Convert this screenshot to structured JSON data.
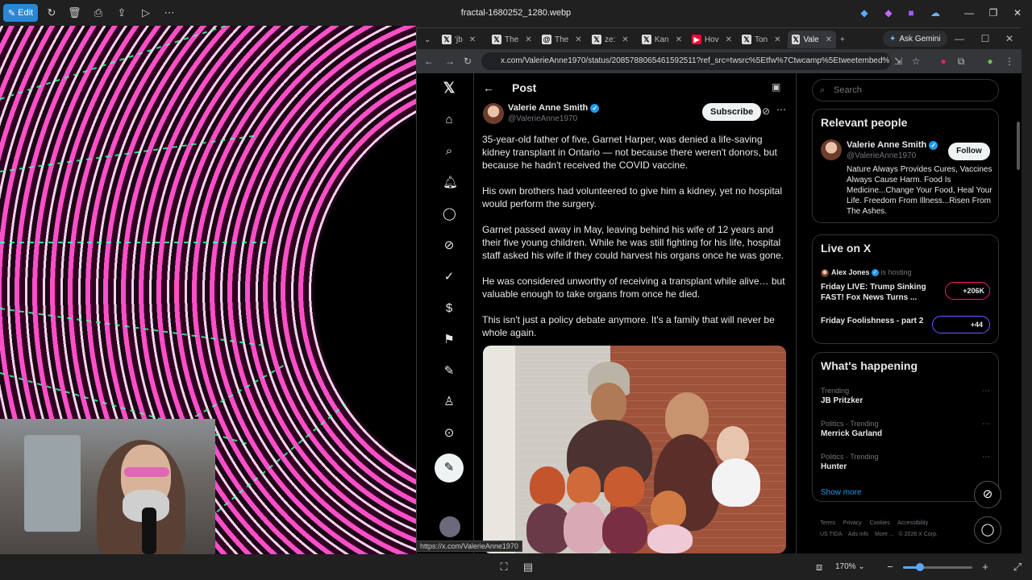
{
  "viewer": {
    "edit_label": "Edit",
    "title": "fractal-1680252_1280.webp",
    "zoom": "170%"
  },
  "browser": {
    "tabs": [
      {
        "label": "'jb",
        "icon": "x-logo-icon"
      },
      {
        "label": "The",
        "icon": "x-logo-icon"
      },
      {
        "label": "The",
        "icon": "threads-icon"
      },
      {
        "label": "ze:",
        "icon": "x-logo-icon"
      },
      {
        "label": "Kan",
        "icon": "x-logo-icon"
      },
      {
        "label": "Hov",
        "icon": "youtube-icon"
      },
      {
        "label": "Ton",
        "icon": "x-logo-icon"
      },
      {
        "label": "Vale",
        "icon": "x-logo-icon"
      }
    ],
    "ask_gemini": "Ask Gemini",
    "url": "x.com/ValerieAnne1970/status/2085788065461592511?ref_src=twsrc%5Etfw%7Ctwcamp%5Etweetembed%7Ctwte...",
    "status_url": "https://x.com/ValerieAnne1970"
  },
  "post": {
    "header": "Post",
    "author_name": "Valerie Anne Smith",
    "author_handle": "@ValerieAnne1970",
    "subscribe_label": "Subscribe",
    "paragraphs": [
      "35-year-old father of five, Garnet Harper, was denied a life-saving kidney transplant in Ontario — not because there weren't donors, but because he hadn't received the COVID vaccine.",
      "His own brothers had volunteered to give him a kidney, yet no hospital would perform the surgery.",
      "Garnet passed away in May, leaving behind his wife of 12 years and their five young children. While he was still fighting for his life, hospital staff asked his wife if they could harvest his organs once he was gone.",
      "He was considered unworthy of receiving a transplant while alive… but valuable enough to take organs from once he died.",
      "This isn't just a policy debate anymore. It's a family that will never be whole again."
    ]
  },
  "sidebar": {
    "search_placeholder": "Search",
    "relevant": {
      "title": "Relevant people",
      "name": "Valerie Anne Smith",
      "handle": "@ValerieAnne1970",
      "follow_label": "Follow",
      "bio": "Nature Always Provides Cures, Vaccines Always Cause Harm. Food Is Medicine...Change Your Food, Heal Your Life. Freedom From Illness...Risen From The Ashes."
    },
    "live": {
      "title": "Live on X",
      "host_name": "Alex Jones",
      "host_status": "is hosting",
      "items": [
        {
          "title": "Friday LIVE: Trump Sinking FAST! Fox News Turns ...",
          "count": "+206K"
        },
        {
          "title": "Friday Foolishness - part 2",
          "count": "+44"
        }
      ]
    },
    "happening": {
      "title": "What's happening",
      "items": [
        {
          "context": "Trending",
          "topic": "JB Pritzker"
        },
        {
          "context": "Politics · Trending",
          "topic": "Merrick Garland"
        },
        {
          "context": "Politics · Trending",
          "topic": "Hunter"
        }
      ],
      "show_more": "Show more"
    },
    "footer": [
      "Terms",
      "Privacy",
      "Cookies",
      "Accessibility",
      "US TIDA",
      "Ads info",
      "More ...",
      "© 2026 X Corp."
    ]
  }
}
